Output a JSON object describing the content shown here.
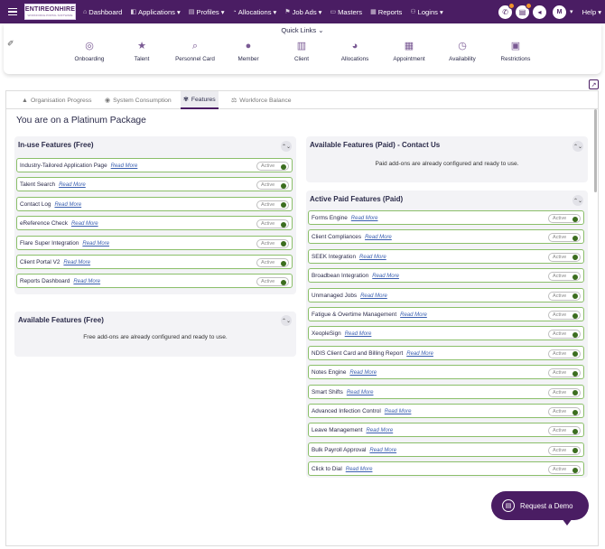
{
  "nav": {
    "logo_text": "ENTIREONHIRE",
    "logo_tagline": "WORKFORCE PORTAL SOFTWARE",
    "menu": [
      {
        "label": "Dashboard",
        "icon": "home-icon",
        "glyph": "⌂",
        "dropdown": false
      },
      {
        "label": "Applications",
        "icon": "applications-icon",
        "glyph": "◧",
        "dropdown": true
      },
      {
        "label": "Profiles",
        "icon": "profiles-icon",
        "glyph": "▤",
        "dropdown": true
      },
      {
        "label": "Allocations",
        "icon": "allocations-icon",
        "glyph": "◔",
        "dropdown": true
      },
      {
        "label": "Job Ads",
        "icon": "job-ads-icon",
        "glyph": "⚑",
        "dropdown": true
      },
      {
        "label": "Masters",
        "icon": "masters-icon",
        "glyph": "▭",
        "dropdown": false
      },
      {
        "label": "Reports",
        "icon": "reports-icon",
        "glyph": "▦",
        "dropdown": false
      },
      {
        "label": "Logins",
        "icon": "logins-icon",
        "glyph": "⚇",
        "dropdown": true
      }
    ],
    "avatar_initial": "M",
    "help_label": "Help"
  },
  "quick_links": {
    "title": "Quick Links",
    "items": [
      {
        "label": "Onboarding",
        "icon": "onboarding-icon",
        "glyph": "◎"
      },
      {
        "label": "Talent",
        "icon": "star-icon",
        "glyph": "★"
      },
      {
        "label": "Personnel Card",
        "icon": "search-person-icon",
        "glyph": "⌕"
      },
      {
        "label": "Member",
        "icon": "member-icon",
        "glyph": "●"
      },
      {
        "label": "Client",
        "icon": "client-icon",
        "glyph": "▥"
      },
      {
        "label": "Allocations",
        "icon": "pie-chart-icon",
        "glyph": "◕"
      },
      {
        "label": "Appointment",
        "icon": "calendar-icon",
        "glyph": "▦"
      },
      {
        "label": "Availability",
        "icon": "clock-icon",
        "glyph": "◷"
      },
      {
        "label": "Restrictions",
        "icon": "lock-icon",
        "glyph": "▣"
      }
    ]
  },
  "tabs": [
    {
      "label": "Organisation Progress",
      "icon": "progress-icon",
      "glyph": "▲",
      "active": false
    },
    {
      "label": "System Consumption",
      "icon": "consumption-icon",
      "glyph": "◉",
      "active": false
    },
    {
      "label": "Features",
      "icon": "features-icon",
      "glyph": "✾",
      "active": true
    },
    {
      "label": "Workforce Balance",
      "icon": "balance-icon",
      "glyph": "⚖",
      "active": false
    }
  ],
  "heading": "You are on a Platinum Package",
  "read_more": "Read More",
  "active_label": "Active",
  "inuse_free": {
    "title": "In-use Features (Free)",
    "items": [
      "Industry-Tailored Application Page",
      "Talent Search",
      "Contact Log",
      "eReference Check",
      "Flare Super Integration",
      "Client Portal V2",
      "Reports Dashboard"
    ]
  },
  "available_free": {
    "title": "Available Features (Free)",
    "note": "Free add-ons are already configured and ready to use."
  },
  "available_paid": {
    "title": "Available Features (Paid) - Contact Us",
    "note": "Paid add-ons are already configured and ready to use."
  },
  "active_paid": {
    "title": "Active Paid Features (Paid)",
    "items": [
      "Forms Engine",
      "Client Compliances",
      "SEEK Integration",
      "Broadbean Integration",
      "Unmanaged Jobs",
      "Fatigue & Overtime Management",
      "XeopleSign",
      "NDIS Client Card and Billing Report",
      "Notes Engine",
      "Smart Shifts",
      "Advanced Infection Control",
      "Leave Management",
      "Bulk Payroll Approval",
      "Click to Dial"
    ]
  },
  "demo_button": "Request a Demo",
  "colors": {
    "brand": "#4a1d63",
    "active_border": "#8bbf6a",
    "toggle": "#3c6e1f"
  }
}
